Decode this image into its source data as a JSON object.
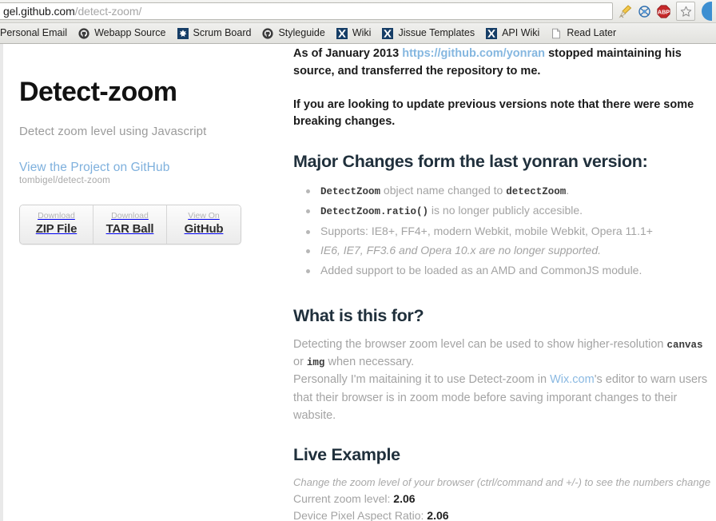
{
  "browser": {
    "url_host": "gel.github.com",
    "url_path": "/detect-zoom/",
    "toolbar_icons": [
      {
        "name": "cleanup-broom-icon",
        "label": "Cleanup"
      },
      {
        "name": "blue-science-icon",
        "label": "Extension"
      },
      {
        "name": "adblock-plus-icon",
        "label": "ABP"
      },
      {
        "name": "bookmark-star-icon",
        "label": "Bookmark this page"
      }
    ],
    "bookmarks": [
      {
        "label": "Personal Email",
        "icon": "none"
      },
      {
        "label": "Webapp Source",
        "icon": "github-octocat-icon"
      },
      {
        "label": "Scrum Board",
        "icon": "jira-icon"
      },
      {
        "label": "Styleguide",
        "icon": "github-octocat-icon"
      },
      {
        "label": "Wiki",
        "icon": "confluence-icon"
      },
      {
        "label": "Jissue Templates",
        "icon": "confluence-icon"
      },
      {
        "label": "API Wiki",
        "icon": "confluence-icon"
      },
      {
        "label": "Read Later",
        "icon": "document-page-icon"
      }
    ]
  },
  "sidebar": {
    "title": "Detect-zoom",
    "tagline": "Detect zoom level using Javascript",
    "project_link": "View the Project on GitHub",
    "repo_path": "tombigel/detect-zoom",
    "downloads": [
      {
        "sub": "Download",
        "main": "ZIP File"
      },
      {
        "sub": "Download",
        "main": "TAR Ball"
      },
      {
        "sub": "View On",
        "main": "GitHub"
      }
    ]
  },
  "content": {
    "intro_1_pre": "As of January 2013 ",
    "intro_1_link": "https://github.com/yonran",
    "intro_1_post": " stopped maintaining his source, and transferred the repository to me.",
    "intro_2": "If you are looking to update previous versions note that there were some breaking changes.",
    "heading_major": "Major Changes form the last yonran version:",
    "bullets": [
      {
        "code1": "DetectZoom",
        "mid": " object name changed to ",
        "code2": "detectZoom",
        "tail": ".",
        "italic": false
      },
      {
        "code1": "DetectZoom.ratio()",
        "mid": " is no longer publicly accesible.",
        "code2": "",
        "tail": "",
        "italic": false
      },
      {
        "code1": "",
        "mid": "Supports: IE8+, FF4+, modern Webkit, mobile Webkit, Opera 11.1+",
        "code2": "",
        "tail": "",
        "italic": false
      },
      {
        "code1": "",
        "mid": "IE6, IE7, FF3.6 and Opera 10.x are no longer supported.",
        "code2": "",
        "tail": "",
        "italic": true
      },
      {
        "code1": "",
        "mid": "Added support to be loaded as an AMD and CommonJS module.",
        "code2": "",
        "tail": "",
        "italic": false
      }
    ],
    "heading_what": "What is this for?",
    "what_p1_a": "Detecting the browser zoom level can be used to show higher-resolution ",
    "what_p1_code1": "canvas",
    "what_p1_b": " or ",
    "what_p1_code2": "img",
    "what_p1_c": " when necessary.",
    "what_p2_a": "Personally I'm maitaining it to use Detect-zoom in ",
    "what_p2_link": "Wix.com",
    "what_p2_b": "'s editor to warn users that their browser is in zoom mode before saving imporant changes to their wabsite.",
    "heading_live": "Live Example",
    "live_note": "Change the zoom level of your browser (ctrl/command and +/-) to see the numbers change",
    "zoom_label": "Current zoom level: ",
    "zoom_value": "2.06",
    "dpr_label": "Device Pixel Aspect Ratio: ",
    "dpr_value": "2.06"
  },
  "colors": {
    "link_blue": "#7eb0dd",
    "heading_dark": "#20303c",
    "body_grey": "#a3a3a3",
    "adblock_red": "#c5292a"
  }
}
